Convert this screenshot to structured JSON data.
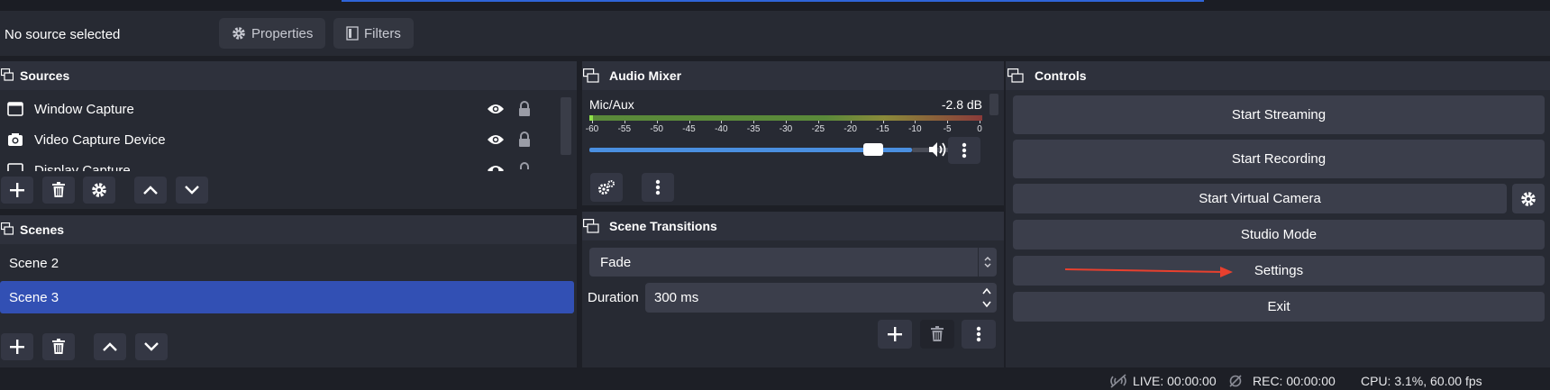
{
  "source_bar": {
    "status": "No source selected",
    "properties_label": "Properties",
    "filters_label": "Filters"
  },
  "sources": {
    "title": "Sources",
    "items": [
      {
        "label": "Window Capture",
        "icon": "window-icon"
      },
      {
        "label": "Video Capture Device",
        "icon": "camera-icon"
      },
      {
        "label": "Display Capture",
        "icon": "monitor-icon"
      }
    ]
  },
  "scenes": {
    "title": "Scenes",
    "items": [
      "Scene 2",
      "Scene 3"
    ],
    "selected": "Scene 3"
  },
  "audio_mixer": {
    "title": "Audio Mixer",
    "channel_name": "Mic/Aux",
    "level": "-2.8 dB",
    "ticks": [
      "-60",
      "-55",
      "-50",
      "-45",
      "-40",
      "-35",
      "-30",
      "-25",
      "-20",
      "-15",
      "-10",
      "-5",
      "0"
    ],
    "volume_fraction": 0.9
  },
  "scene_transitions": {
    "title": "Scene Transitions",
    "transition": "Fade",
    "duration_label": "Duration",
    "duration_value": "300 ms"
  },
  "controls": {
    "title": "Controls",
    "start_streaming": "Start Streaming",
    "start_recording": "Start Recording",
    "start_virtual_camera": "Start Virtual Camera",
    "studio_mode": "Studio Mode",
    "settings": "Settings",
    "exit": "Exit"
  },
  "status_bar": {
    "live": "LIVE: 00:00:00",
    "rec": "REC: 00:00:00",
    "cpu": "CPU: 3.1%, 60.00 fps"
  },
  "colors": {
    "selection": "#3250b4",
    "annotation_arrow": "#e8402e",
    "slider": "#4a8fe0"
  }
}
